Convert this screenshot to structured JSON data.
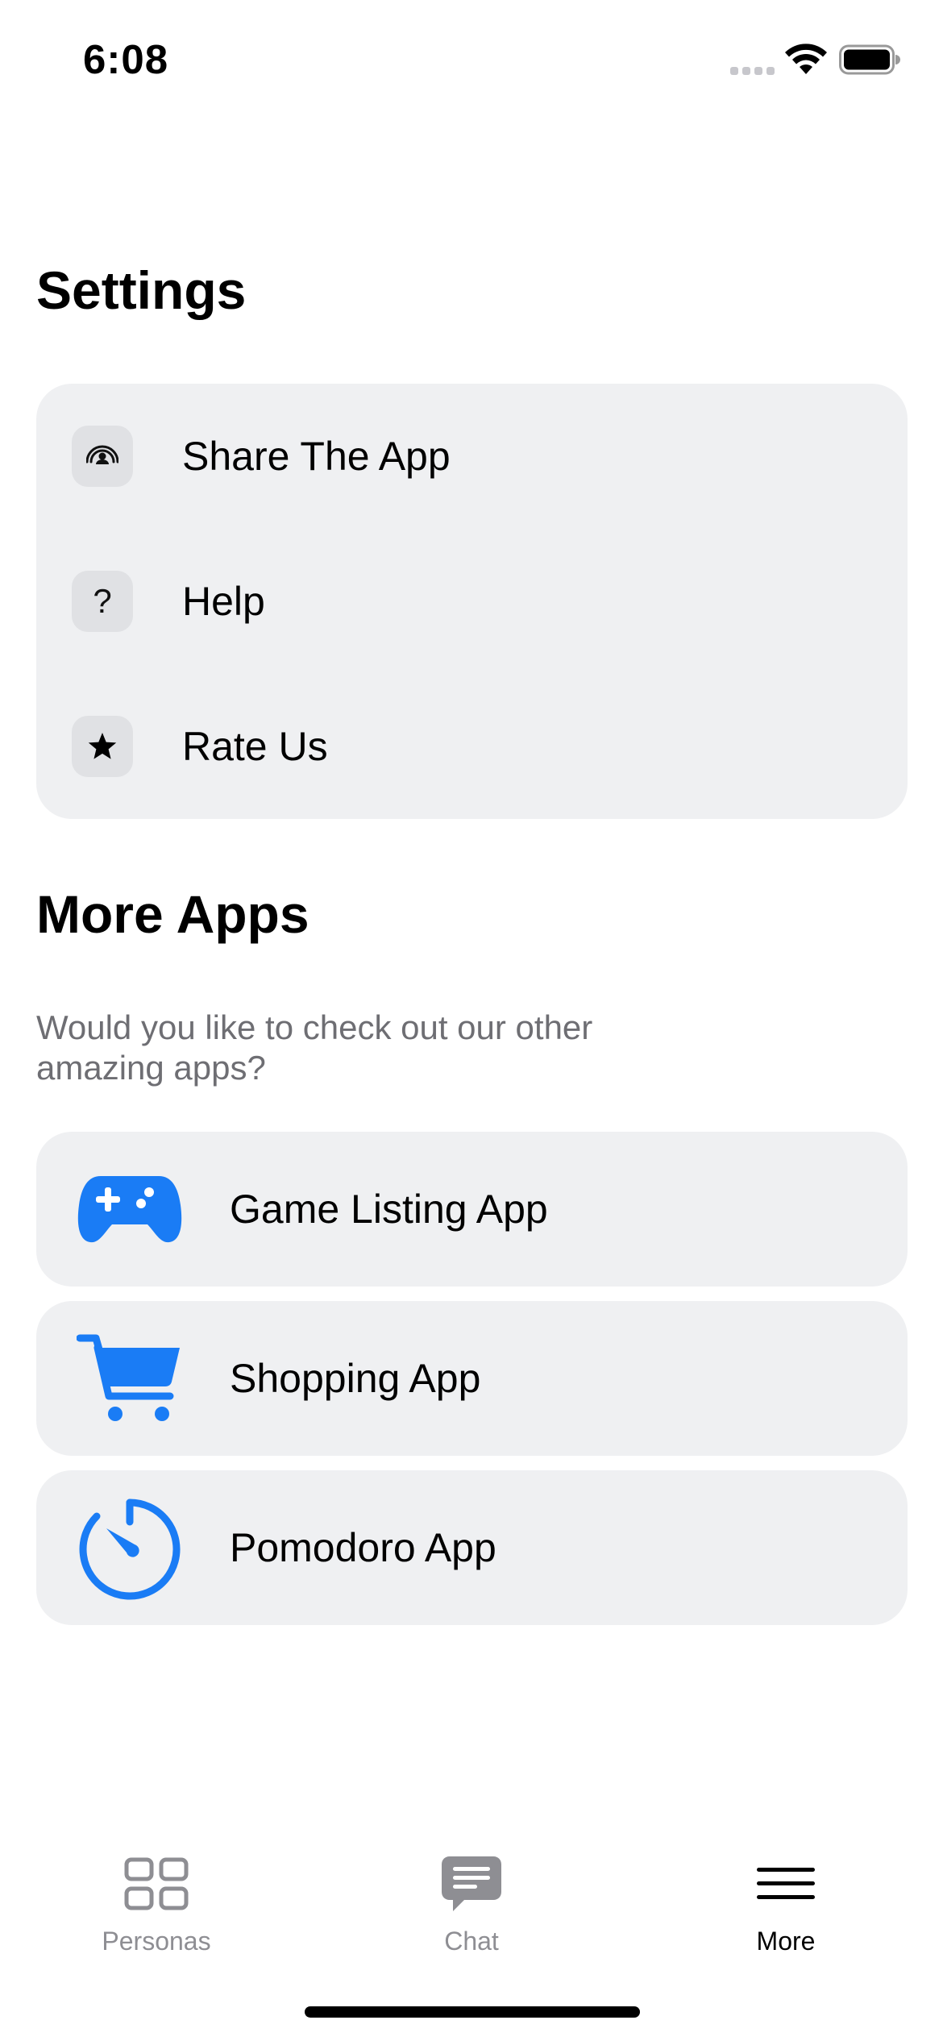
{
  "status_bar": {
    "time": "6:08"
  },
  "settings": {
    "title": "Settings",
    "items": [
      {
        "label": "Share The App",
        "icon": "share-icon"
      },
      {
        "label": "Help",
        "icon": "question-icon"
      },
      {
        "label": "Rate Us",
        "icon": "star-icon"
      }
    ]
  },
  "more_apps": {
    "title": "More Apps",
    "description": "Would you like to check out our other amazing apps?",
    "apps": [
      {
        "label": "Game Listing App",
        "icon": "gamepad-icon"
      },
      {
        "label": "Shopping App",
        "icon": "cart-icon"
      },
      {
        "label": "Pomodoro App",
        "icon": "timer-icon"
      }
    ]
  },
  "tab_bar": {
    "tabs": [
      {
        "label": "Personas",
        "icon": "grid-icon",
        "active": false
      },
      {
        "label": "Chat",
        "icon": "chat-bubble-icon",
        "active": false
      },
      {
        "label": "More",
        "icon": "menu-icon",
        "active": true
      }
    ]
  },
  "colors": {
    "accent": "#1a7cf5",
    "card_background": "#eff0f2",
    "icon_tile": "#e0e1e4",
    "inactive_tab": "#8e8e93",
    "secondary_text": "#6e6e73"
  }
}
